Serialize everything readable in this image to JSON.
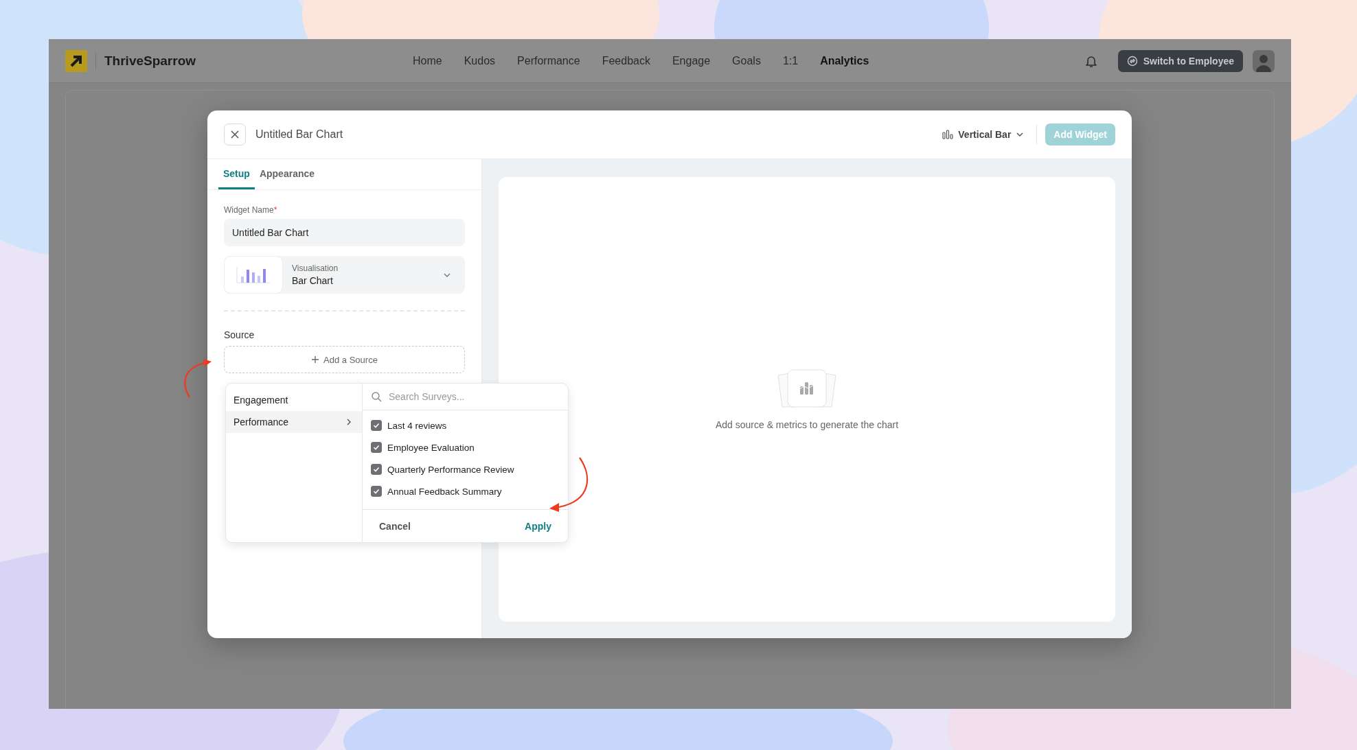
{
  "app": {
    "logo_name": "ThriveSparrow",
    "nav": [
      {
        "label": "Home",
        "selected": false
      },
      {
        "label": "Kudos",
        "selected": false
      },
      {
        "label": "Performance",
        "selected": false
      },
      {
        "label": "Feedback",
        "selected": false
      },
      {
        "label": "Engage",
        "selected": false
      },
      {
        "label": "Goals",
        "selected": false
      },
      {
        "label": "1:1",
        "selected": false
      },
      {
        "label": "Analytics",
        "selected": true
      }
    ],
    "switch_button": "Switch to Employee"
  },
  "modal": {
    "title": "Untitled Bar Chart",
    "chart_type": "Vertical Bar",
    "add_button": {
      "label": "Add Widget",
      "disabled": true
    },
    "tabs": [
      {
        "label": "Setup",
        "selected": true
      },
      {
        "label": "Appearance",
        "selected": false
      }
    ],
    "widget_name": {
      "label": "Widget Name",
      "required_mark": "*",
      "value": "Untitled Bar Chart"
    },
    "visualisation": {
      "label": "Visualisation",
      "value": "Bar Chart"
    },
    "source": {
      "label": "Source",
      "add_button": "Add a Source"
    },
    "source_menu": {
      "categories": [
        {
          "label": "Engagement",
          "selected": false
        },
        {
          "label": "Performance",
          "selected": true
        }
      ],
      "search": {
        "placeholder": "Search Surveys..."
      },
      "surveys": [
        {
          "label": "Last 4 reviews",
          "checked": true
        },
        {
          "label": "Employee Evaluation",
          "checked": true
        },
        {
          "label": "Quarterly Performance Review",
          "checked": true
        },
        {
          "label": "Annual Feedback Summary",
          "checked": true
        }
      ],
      "cancel": "Cancel",
      "apply": "Apply"
    },
    "empty_state": {
      "message": "Add source & metrics to generate the chart"
    }
  }
}
